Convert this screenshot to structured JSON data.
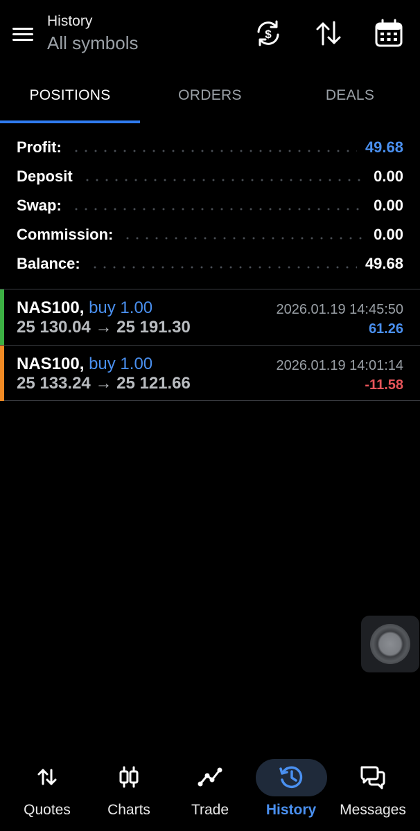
{
  "header": {
    "title_small": "History",
    "title_big": "All symbols",
    "icons": [
      "menu-icon",
      "sync-currency-icon",
      "sort-icon",
      "calendar-icon"
    ]
  },
  "tabs": [
    {
      "label": "POSITIONS",
      "active": true
    },
    {
      "label": "ORDERS",
      "active": false
    },
    {
      "label": "DEALS",
      "active": false
    }
  ],
  "summary": [
    {
      "label": "Profit:",
      "value": "49.68"
    },
    {
      "label": "Deposit",
      "value": "0.00"
    },
    {
      "label": "Swap:",
      "value": "0.00"
    },
    {
      "label": "Commission:",
      "value": "0.00"
    },
    {
      "label": "Balance:",
      "value": "49.68"
    }
  ],
  "positions": [
    {
      "symbol": "NAS100,",
      "side": "buy 1.00",
      "prices": "25 130.04 → 25 191.30",
      "datetime": "2026.01.19 14:45:50",
      "profit": "61.26",
      "profit_color": "#4a90f0",
      "bar_color": "#3cb043"
    },
    {
      "symbol": "NAS100,",
      "side": "buy 1.00",
      "prices": "25 133.24 → 25 121.66",
      "datetime": "2026.01.19 14:01:14",
      "profit": "-11.58",
      "profit_color": "#e8555a",
      "bar_color": "#f08a24"
    }
  ],
  "bottom_nav": [
    {
      "label": "Quotes",
      "icon": "quotes-icon",
      "active": false
    },
    {
      "label": "Charts",
      "icon": "charts-icon",
      "active": false
    },
    {
      "label": "Trade",
      "icon": "trade-icon",
      "active": false
    },
    {
      "label": "History",
      "icon": "history-icon",
      "active": true
    },
    {
      "label": "Messages",
      "icon": "messages-icon",
      "active": false
    }
  ],
  "colors": {
    "accent": "#2f7bf0",
    "profit_positive": "#4a90f0",
    "profit_negative": "#e8555a",
    "background": "#000000"
  }
}
